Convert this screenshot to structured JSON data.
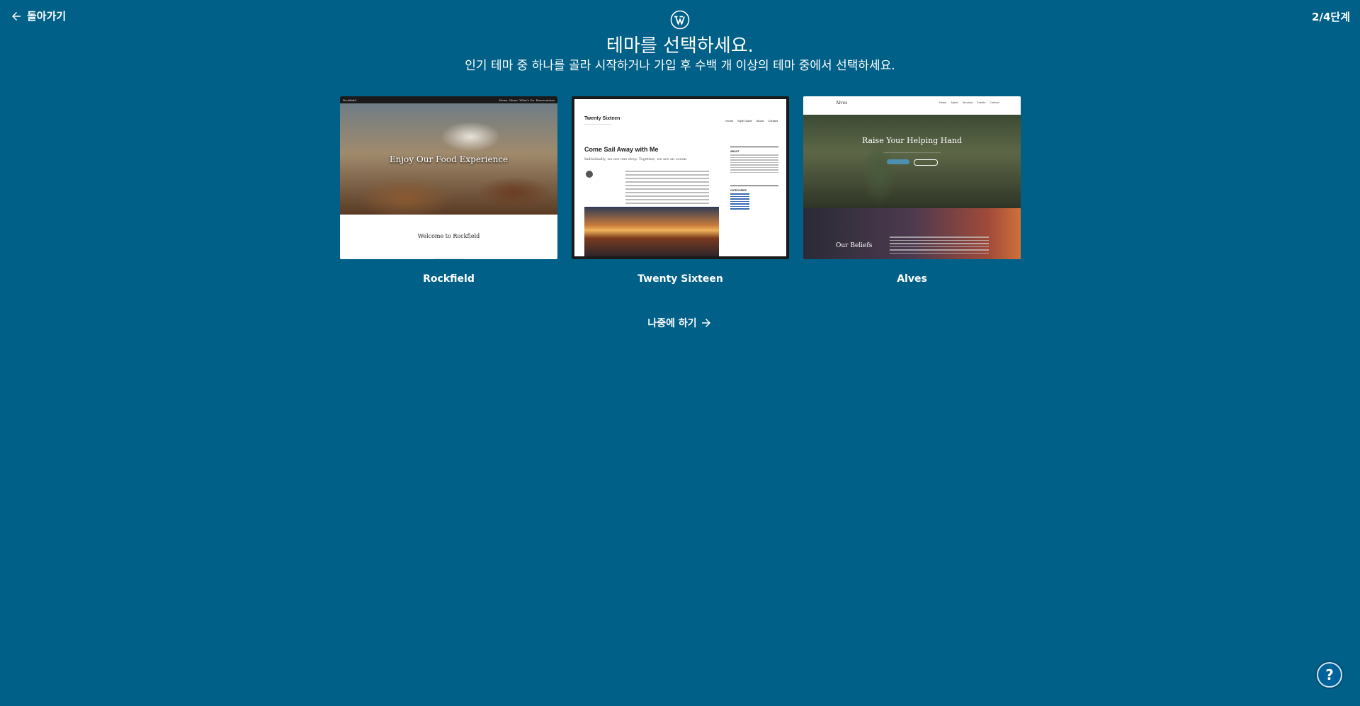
{
  "header": {
    "back_label": "돌아가기",
    "step_label": "2/4단계",
    "logo_icon": "wordpress-logo-icon"
  },
  "main": {
    "title": "테마를 선택하세요.",
    "subtitle": "인기 테마 중 하나를 골라 시작하거나 가입 후 수백 개 이상의 테마 중에서 선택하세요."
  },
  "themes": [
    {
      "name": "Rockfield",
      "preview": {
        "site_title": "Rockfield",
        "nav": [
          "Home",
          "Menu",
          "What's On",
          "Reservations"
        ],
        "hero_text": "Enjoy Our Food Experience",
        "section_title": "Welcome to Rockfield"
      }
    },
    {
      "name": "Twenty Sixteen",
      "preview": {
        "site_title": "Twenty Sixteen",
        "nav": [
          "Home",
          "Style Guide",
          "About",
          "Contact"
        ],
        "post_title": "Come Sail Away with Me",
        "post_excerpt": "Individually, we are one drop. Together, we are an ocean.",
        "sidebar_about": "ABOUT",
        "sidebar_categories": "CATEGORIES"
      }
    },
    {
      "name": "Alves",
      "preview": {
        "site_title": "Alves",
        "nav": [
          "Home",
          "About",
          "Services",
          "Events",
          "Contact"
        ],
        "hero_text": "Raise Your Helping Hand",
        "section_title": "Our Beliefs"
      }
    }
  ],
  "later_label": "나중에 하기",
  "help_icon": "help-icon"
}
